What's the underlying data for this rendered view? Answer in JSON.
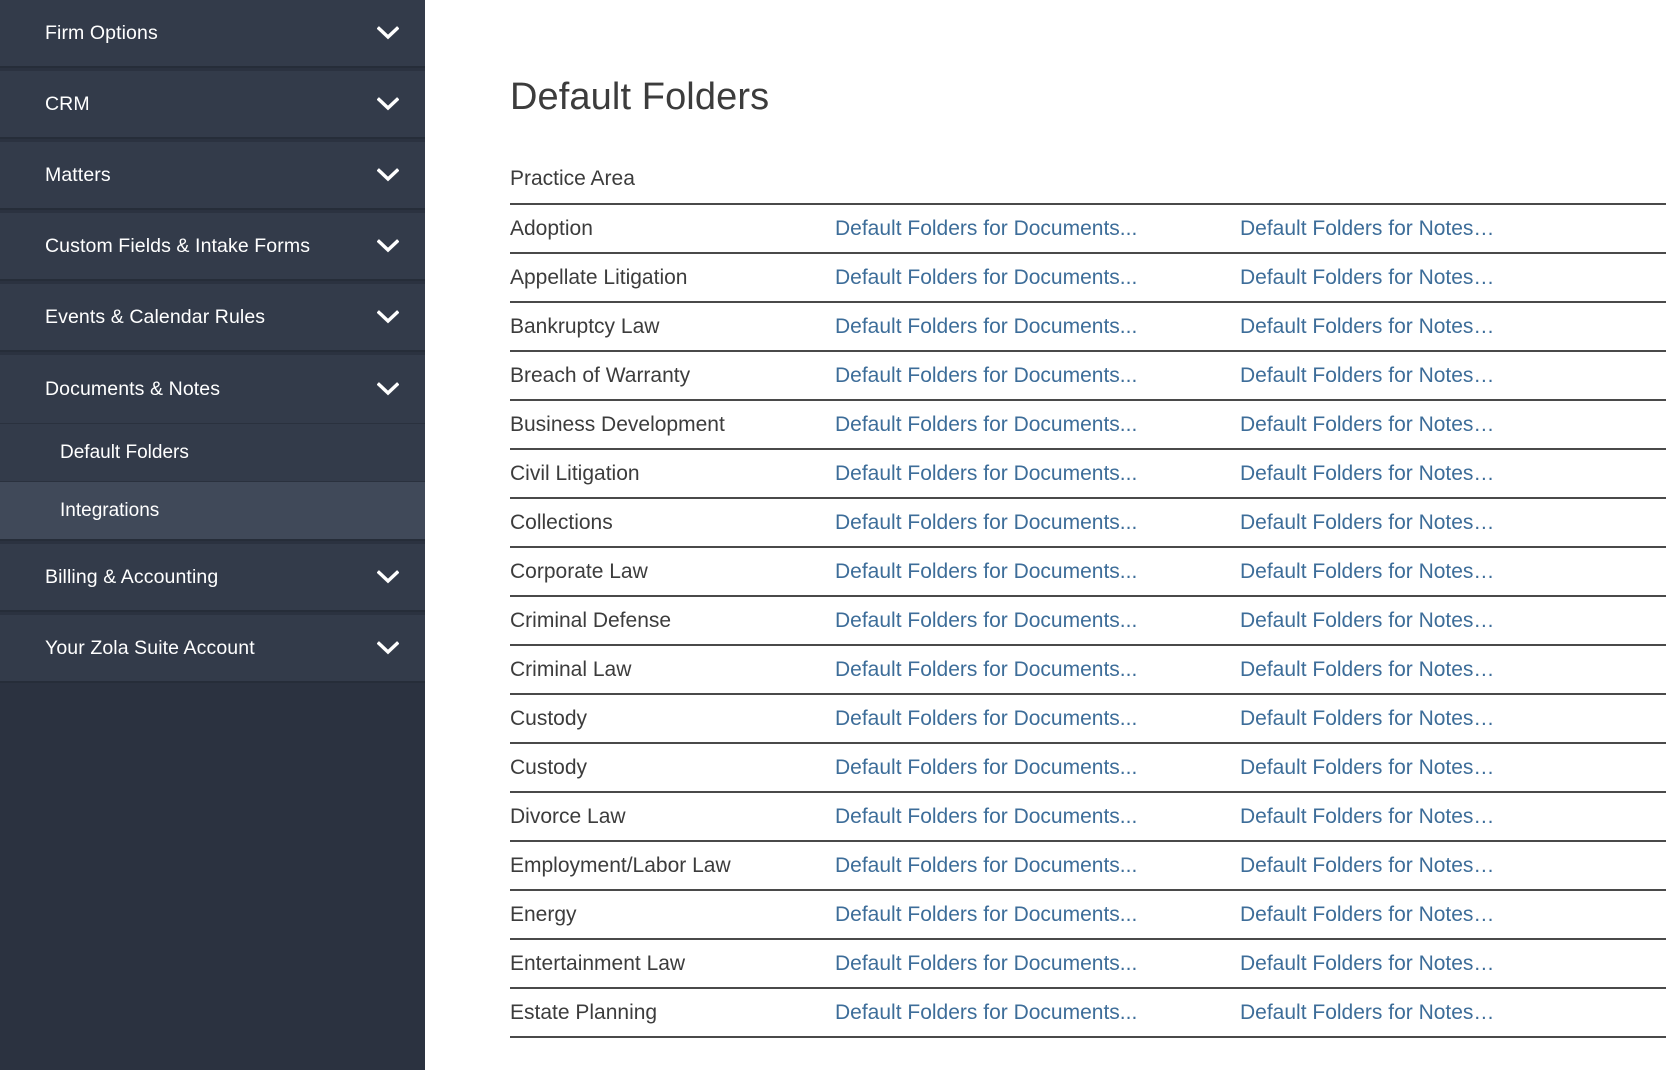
{
  "sidebar": {
    "items": [
      {
        "label": "Firm Options",
        "icon": "chevron-down-icon",
        "expanded": false
      },
      {
        "label": "CRM",
        "icon": "chevron-down-icon",
        "expanded": false
      },
      {
        "label": "Matters",
        "icon": "chevron-down-icon",
        "expanded": false
      },
      {
        "label": "Custom Fields & Intake Forms",
        "icon": "chevron-down-icon",
        "expanded": false
      },
      {
        "label": "Events & Calendar Rules",
        "icon": "chevron-down-icon",
        "expanded": false
      },
      {
        "label": "Documents & Notes",
        "icon": "chevron-down-icon",
        "expanded": true
      },
      {
        "label": "Billing & Accounting",
        "icon": "chevron-down-icon",
        "expanded": false
      },
      {
        "label": "Your Zola Suite Account",
        "icon": "chevron-down-icon",
        "expanded": false
      }
    ],
    "sub_items": [
      {
        "label": "Default Folders",
        "active": false
      },
      {
        "label": "Integrations",
        "active": true
      }
    ],
    "colors": {
      "background": "#2b3240",
      "item_background": "#333b4a",
      "active_background": "#404959",
      "text": "#ffffff"
    }
  },
  "main": {
    "page_title": "Default Folders",
    "table": {
      "headers": [
        "Practice Area",
        "",
        ""
      ],
      "link_documents_label": "Default Folders for Documents...",
      "link_notes_label": "Default Folders for Notes…",
      "rows": [
        {
          "practice_area": "Adoption"
        },
        {
          "practice_area": "Appellate Litigation"
        },
        {
          "practice_area": "Bankruptcy Law"
        },
        {
          "practice_area": "Breach of Warranty"
        },
        {
          "practice_area": "Business Development"
        },
        {
          "practice_area": "Civil Litigation"
        },
        {
          "practice_area": "Collections"
        },
        {
          "practice_area": "Corporate Law"
        },
        {
          "practice_area": "Criminal Defense"
        },
        {
          "practice_area": "Criminal Law"
        },
        {
          "practice_area": "Custody"
        },
        {
          "practice_area": "Custody"
        },
        {
          "practice_area": "Divorce Law"
        },
        {
          "practice_area": "Employment/Labor Law"
        },
        {
          "practice_area": "Energy"
        },
        {
          "practice_area": "Entertainment Law"
        },
        {
          "practice_area": "Estate Planning"
        }
      ]
    },
    "colors": {
      "link": "#3d6d99",
      "text": "#3c3c3c",
      "row_border": "#4a4a4a"
    }
  }
}
